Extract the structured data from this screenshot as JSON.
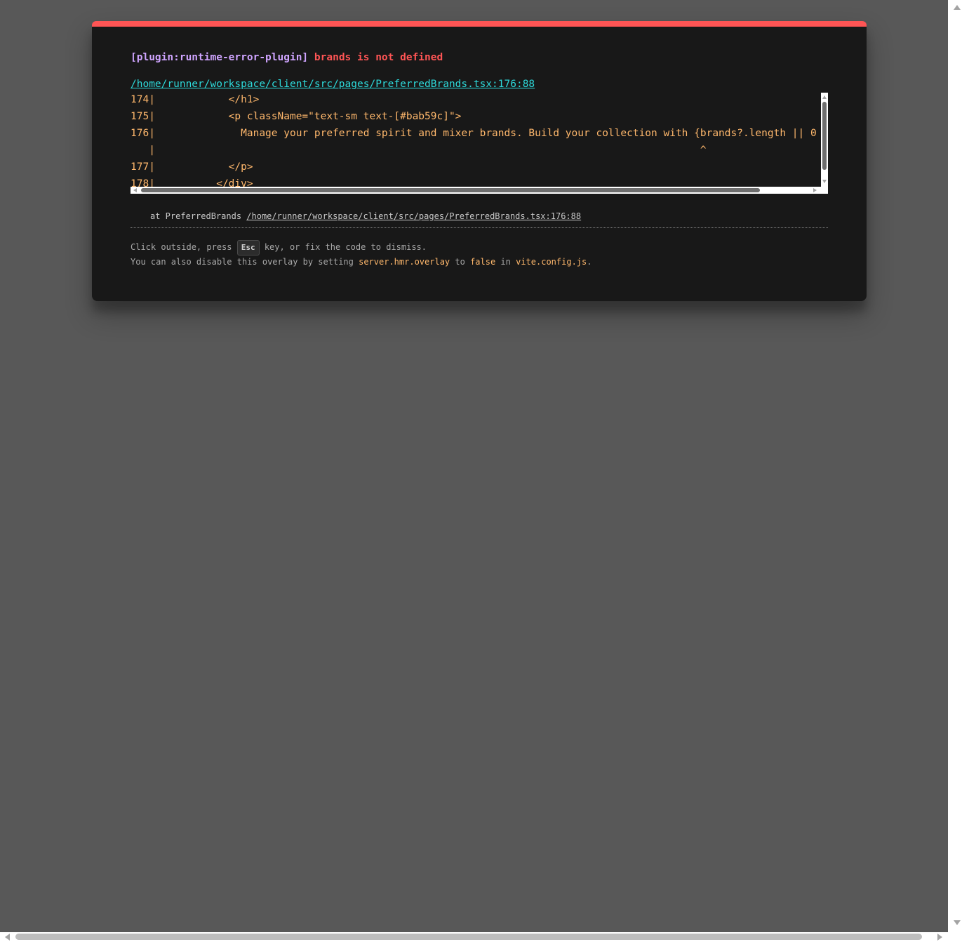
{
  "error": {
    "plugin": "[plugin:runtime-error-plugin]",
    "message": "brands is not defined",
    "file": "/home/runner/workspace/client/src/pages/PreferredBrands.tsx:176:88"
  },
  "frame": {
    "lines": [
      "174|            </h1>",
      "175|            <p className=\"text-sm text-[#bab59c]\">",
      "176|              Manage your preferred spirit and mixer brands. Build your collection with {brands?.length || 0",
      "   |                                                                                         ^",
      "177|            </p>",
      "178|          </div>"
    ]
  },
  "stack": {
    "prefix": "at PreferredBrands ",
    "location": "/home/runner/workspace/client/src/pages/PreferredBrands.tsx:176:88"
  },
  "tip": {
    "line1_prefix": "Click outside, press ",
    "key": "Esc",
    "line1_suffix": " key, or fix the code to dismiss.",
    "line2_prefix": "You can also disable this overlay by setting ",
    "setting": "server.hmr.overlay",
    "to": " to ",
    "value": "false",
    "in": " in ",
    "config_file": "vite.config.js",
    "end": "."
  },
  "colors": {
    "accent_bar": "#ff5555",
    "plugin_label": "#cfa4ff",
    "message": "#ff5555",
    "link": "#2dd9da",
    "code": "#ffb86c",
    "window_bg": "#181818",
    "backdrop": "#585858"
  }
}
